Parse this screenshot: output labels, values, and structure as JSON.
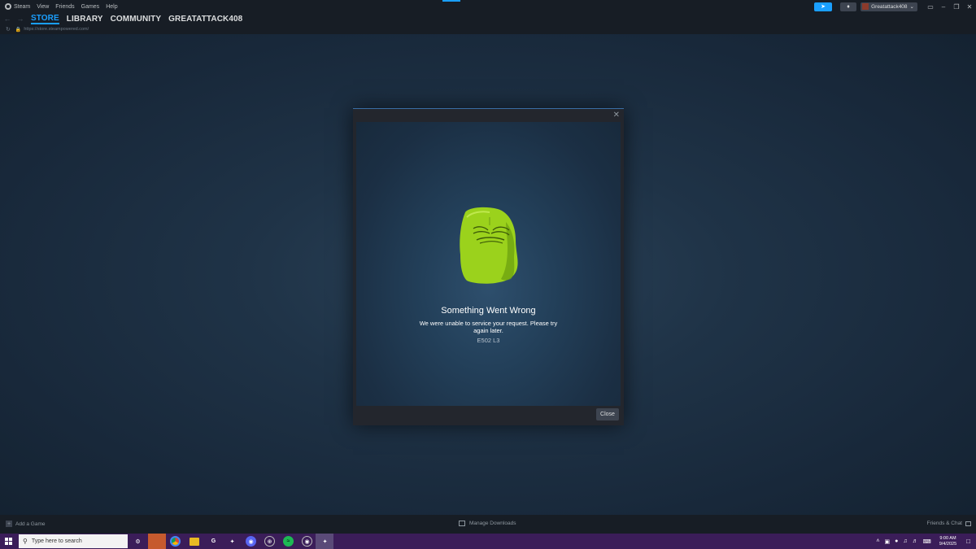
{
  "menubar": {
    "items": [
      "Steam",
      "View",
      "Friends",
      "Games",
      "Help"
    ],
    "username": "Greatattack408"
  },
  "nav": {
    "tabs": [
      "STORE",
      "LIBRARY",
      "COMMUNITY",
      "GREATATTACK408"
    ],
    "active_tab": "STORE"
  },
  "url": "https://store.steampowered.com/",
  "dialog": {
    "title": "Something Went Wrong",
    "message": "We were unable to service your request. Please try again later.",
    "code": "E502 L3",
    "close_label": "Close"
  },
  "bottombar": {
    "add_game": "Add a Game",
    "manage_downloads": "Manage Downloads",
    "friends_chat": "Friends & Chat"
  },
  "taskbar": {
    "search_placeholder": "Type here to search",
    "time": "9:00 AM",
    "date": "9/4/2025"
  },
  "colors": {
    "accent": "#1a9fff",
    "background": "#1b2838",
    "chrome": "#171d25",
    "mascot_green": "#9bd21c",
    "taskbar": "#3b1d59"
  }
}
